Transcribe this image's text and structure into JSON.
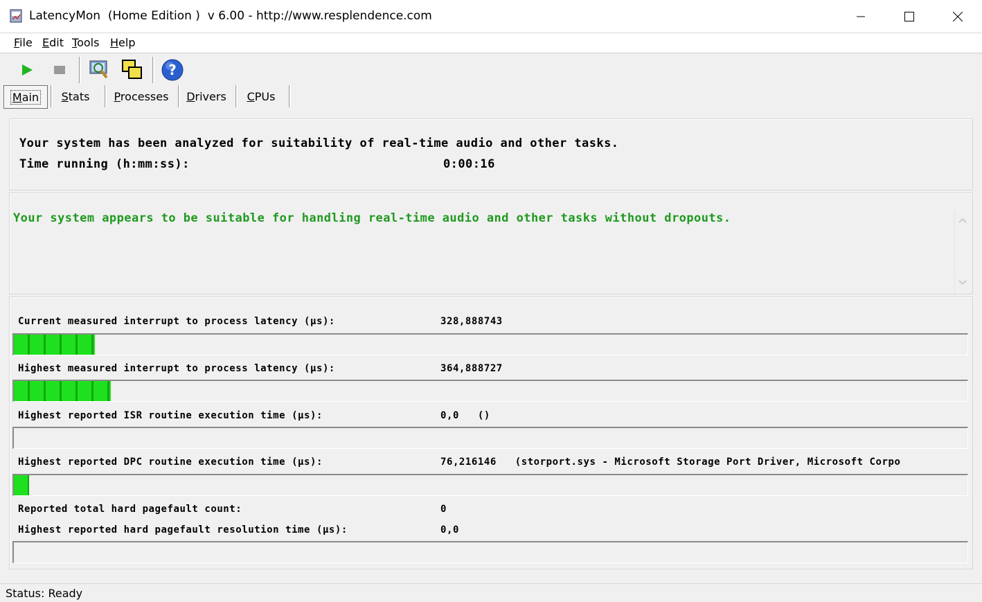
{
  "window": {
    "title": "LatencyMon  (Home Edition )  v 6.00 - http://www.resplendence.com",
    "icon": "latencymon-app-icon"
  },
  "menu": {
    "file": "File",
    "edit": "Edit",
    "tools": "Tools",
    "help": "Help"
  },
  "toolbar": {
    "icons": [
      "play-icon",
      "stop-icon",
      "analyze-icon",
      "windows-icon",
      "help-icon"
    ]
  },
  "tabs": {
    "main": "Main",
    "stats": "Stats",
    "processes": "Processes",
    "drivers": "Drivers",
    "cpus": "CPUs"
  },
  "summary": {
    "line1": "Your system has been analyzed for suitability of real-time audio and other tasks.",
    "running_label": "Time running (h:mm:ss):",
    "running_value": "0:00:16"
  },
  "verdict": {
    "text": "Your system appears to be suitable for handling real-time audio and other tasks without dropouts.",
    "color": "#1f9a1f"
  },
  "metrics": {
    "current_latency": {
      "label": "Current measured interrupt to process latency (µs):",
      "value": "328,888743",
      "level": 0.085
    },
    "highest_latency": {
      "label": "Highest measured interrupt to process latency (µs):",
      "value": "364,888727",
      "level": 0.102
    },
    "isr": {
      "label": "Highest reported ISR routine execution time (µs):",
      "value": "0,0   ()",
      "level": 0
    },
    "dpc": {
      "label": "Highest reported DPC routine execution time (µs):",
      "value": "76,216146   (storport.sys - Microsoft Storage Port Driver, Microsoft Corpo",
      "level": 0.016
    },
    "pagefault_count": {
      "label": "Reported total hard pagefault count:",
      "value": "0"
    },
    "pagefault_time": {
      "label": "Highest reported hard pagefault resolution time (µs):",
      "value": "0,0",
      "level": 0
    }
  },
  "status": {
    "text": "Status: Ready"
  },
  "colors": {
    "meter_green": "#1ee01e",
    "meter_dark": "#0fa80f",
    "background": "#f0f0f0"
  }
}
